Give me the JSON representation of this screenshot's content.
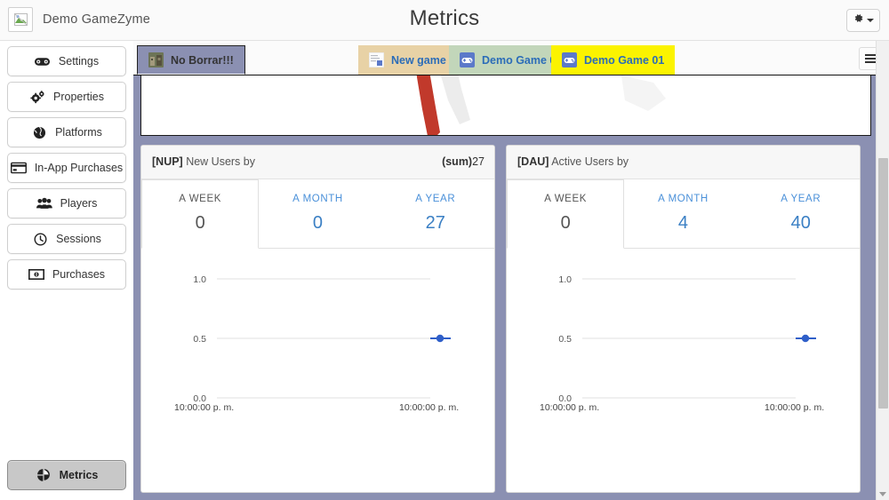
{
  "header": {
    "brand": "Demo GameZyme",
    "title": "Metrics",
    "logo_icon": "broken-image-icon",
    "gear_icon": "gear-icon",
    "gear_caret": "chevron-down-icon"
  },
  "sidebar": {
    "items": [
      {
        "label": "Settings",
        "icon": "gamepad-icon"
      },
      {
        "label": "Properties",
        "icon": "gears-icon"
      },
      {
        "label": "Platforms",
        "icon": "globe-icon"
      },
      {
        "label": "In-App Purchases",
        "icon": "credit-card-icon"
      },
      {
        "label": "Players",
        "icon": "users-icon"
      },
      {
        "label": "Sessions",
        "icon": "clock-icon"
      },
      {
        "label": "Purchases",
        "icon": "money-bill-icon"
      }
    ],
    "bottom": {
      "label": "Metrics",
      "icon": "pie-chart-icon",
      "active": true
    }
  },
  "tabs": {
    "menu_icon": "hamburger-menu-icon",
    "items": [
      {
        "label": "No Borrar!!!",
        "icon": "game-thumbnail-icon",
        "color": "#8b90b2",
        "selected": true
      },
      {
        "label": "New game",
        "icon": "new-game-thumbnail-icon",
        "color": "#e8d2a6",
        "selected": false
      },
      {
        "label": "Demo Game 02",
        "icon": "gamepad-blue-icon",
        "color": "#c2d6ba",
        "selected": false
      },
      {
        "label": "Demo Game 01",
        "icon": "gamepad-blue-icon",
        "color": "#fbf300",
        "selected": false
      }
    ]
  },
  "map": {
    "highlight_color": "#c1392b",
    "land_color": "#f0f0f0"
  },
  "cards": [
    {
      "code": "[NUP]",
      "title": " New Users by",
      "sum_label": "(sum)",
      "sum_value": "27",
      "ranges": [
        {
          "label": "A WEEK",
          "value": "0",
          "active": true
        },
        {
          "label": "A MONTH",
          "value": "0",
          "active": false
        },
        {
          "label": "A YEAR",
          "value": "27",
          "active": false
        }
      ],
      "chart_data": {
        "type": "line",
        "title": "[NUP] New Users by",
        "xlabel": "",
        "ylabel": "",
        "ylim": [
          0.0,
          1.0
        ],
        "yticks": [
          "0.0",
          "0.5",
          "1.0"
        ],
        "xticks": [
          "10:00:00 p. m.",
          "10:00:00 p. m."
        ],
        "grid": true,
        "legend": "none",
        "series": [
          {
            "name": "New Users",
            "x": [
              "10:00:00 p. m."
            ],
            "values": [
              0.5
            ],
            "color": "#2f5fc9"
          }
        ]
      }
    },
    {
      "code": "[DAU]",
      "title": " Active Users by",
      "sum_label": "",
      "sum_value": "",
      "ranges": [
        {
          "label": "A WEEK",
          "value": "0",
          "active": true
        },
        {
          "label": "A MONTH",
          "value": "4",
          "active": false
        },
        {
          "label": "A YEAR",
          "value": "40",
          "active": false
        }
      ],
      "chart_data": {
        "type": "line",
        "title": "[DAU] Active Users by",
        "xlabel": "",
        "ylabel": "",
        "ylim": [
          0.0,
          1.0
        ],
        "yticks": [
          "0.0",
          "0.5",
          "1.0"
        ],
        "xticks": [
          "10:00:00 p. m.",
          "10:00:00 p. m."
        ],
        "grid": true,
        "legend": "none",
        "series": [
          {
            "name": "Active Users",
            "x": [
              "10:00:00 p. m."
            ],
            "values": [
              0.5
            ],
            "color": "#2f5fc9"
          }
        ]
      }
    }
  ],
  "colors": {
    "panel_bg": "#8b90b2",
    "accent_blue": "#3a7fc4",
    "marker_blue": "#2f5fc9"
  }
}
